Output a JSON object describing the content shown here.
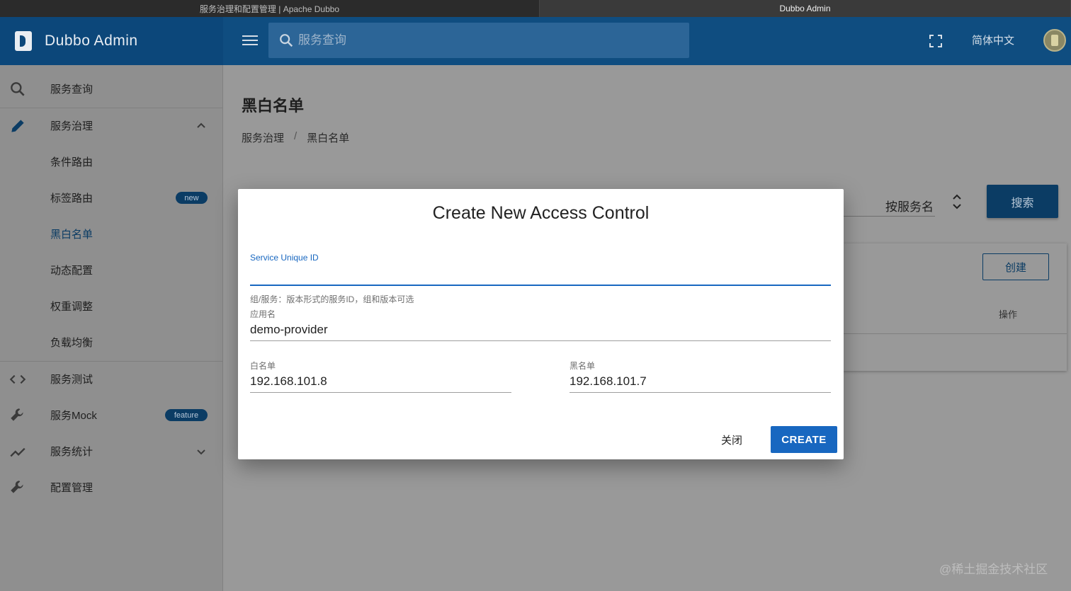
{
  "browser": {
    "tab1_title": "服务治理和配置管理 | Apache Dubbo",
    "tab2_title": "Dubbo Admin"
  },
  "appbar": {
    "brand": "Dubbo Admin",
    "search_placeholder": "服务查询",
    "language": "简体中文"
  },
  "sidebar": {
    "items": [
      {
        "label": "服务查询",
        "icon": "search-icon"
      },
      {
        "label": "服务治理",
        "icon": "pencil-icon"
      },
      {
        "label": "条件路由"
      },
      {
        "label": "标签路由",
        "badge": "new"
      },
      {
        "label": "黑白名单"
      },
      {
        "label": "动态配置"
      },
      {
        "label": "权重调整"
      },
      {
        "label": "负载均衡"
      },
      {
        "label": "服务测试",
        "icon": "code-icon"
      },
      {
        "label": "服务Mock",
        "icon": "wrench-icon",
        "badge": "feature"
      },
      {
        "label": "服务统计",
        "icon": "trending-icon"
      },
      {
        "label": "配置管理",
        "icon": "wrench-icon"
      }
    ]
  },
  "main": {
    "page_title": "黑白名单",
    "breadcrumb": [
      "服务治理",
      "/",
      "黑白名单"
    ],
    "filter_value": "按服务名",
    "search_button": "搜索",
    "create_button": "创建",
    "column_operation": "操作",
    "watermark": "@稀土掘金技术社区"
  },
  "dialog": {
    "title": "Create New Access Control",
    "service_id_label": "Service Unique ID",
    "service_id_value": "",
    "service_id_hint": "组/服务：版本形式的服务ID，组和版本可选",
    "app_name_label": "应用名",
    "app_name_value": "demo-provider",
    "whitelist_label": "白名单",
    "whitelist_value": "192.168.101.8",
    "blacklist_label": "黑名单",
    "blacklist_value": "192.168.101.7",
    "close_button": "关闭",
    "create_button": "CREATE"
  },
  "colors": {
    "primary": "#1867c0",
    "appbar": "#0f4d80",
    "overlay_bg": "#999999"
  }
}
